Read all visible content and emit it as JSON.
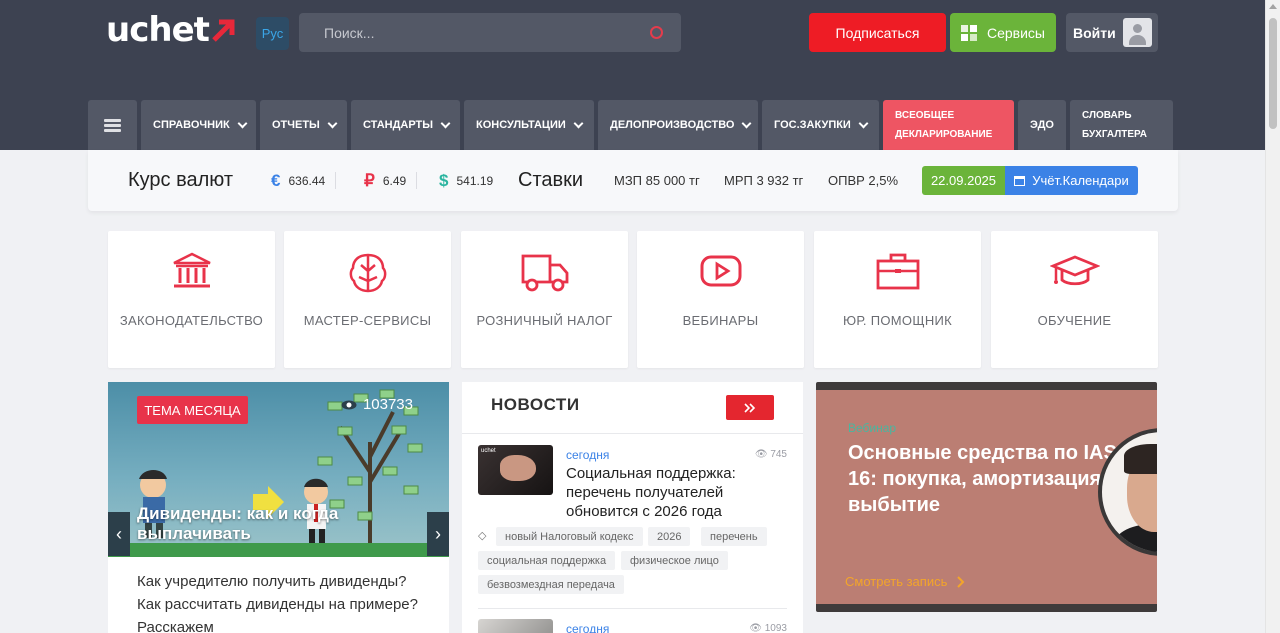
{
  "header": {
    "logo": "uchet",
    "lang": "Рус",
    "search_placeholder": "Поиск...",
    "subscribe": "Подписаться",
    "services": "Сервисы",
    "login": "Войти"
  },
  "nav": {
    "items": [
      "СПРАВОЧНИК",
      "ОТЧЕТЫ",
      "СТАНДАРТЫ",
      "КОНСУЛЬТАЦИИ",
      "ДЕЛОПРОИЗВОДСТВО",
      "ГОС.ЗАКУПКИ"
    ],
    "highlight_line1": "ВСЕОБЩЕЕ",
    "highlight_line2": "ДЕКЛАРИРОВАНИЕ",
    "edo": "ЭДО",
    "dict_line1": "СЛОВАРЬ",
    "dict_line2": "БУХГАЛТЕРА"
  },
  "rates": {
    "title": "Курс валют",
    "eur_symbol": "€",
    "eur": "636.44",
    "rub_symbol": "₽",
    "rub": "6.49",
    "usd_symbol": "$",
    "usd": "541.19",
    "stavki": "Ставки",
    "mzp": "МЗП 85 000 тг",
    "mrp": "МРП 3 932 тг",
    "opvr": "ОПВР 2,5%",
    "date": "22.09.2025",
    "calendar": "Учёт.Календари"
  },
  "tiles": [
    "ЗАКОНОДАТЕЛЬСТВО",
    "МАСТЕР-СЕРВИСЫ",
    "РОЗНИЧНЫЙ НАЛОГ",
    "ВЕБИНАРЫ",
    "ЮР. ПОМОЩНИК",
    "ОБУЧЕНИЕ"
  ],
  "theme": {
    "badge": "ТЕМА МЕСЯЦА",
    "views": "103733",
    "title": "Дивиденды: как и когда выплачивать",
    "desc": "Как учредителю получить дивиденды? Как рассчитать дивиденды на примере? Расскажем"
  },
  "news": {
    "heading": "НОВОСТИ",
    "item1": {
      "date": "сегодня",
      "views": "745",
      "title": "Социальная поддержка: перечень получателей обновится с 2026 года",
      "tags": [
        "новый Налоговый кодекс",
        "2026",
        "перечень",
        "социальная поддержка",
        "физическое лицо",
        "безвозмездная передача"
      ]
    },
    "item2": {
      "date": "сегодня",
      "views": "1093"
    }
  },
  "banner": {
    "tag": "Вебинар",
    "title": "Основные средства по IAS 16: покупка, амортизация, выбытие",
    "cta": "Смотреть запись"
  },
  "colors": {
    "accent_red": "#ee1c25",
    "green": "#6bb43a",
    "blue": "#3b82e6",
    "nav_bg": "#535866",
    "header_bg": "#3d4251"
  }
}
